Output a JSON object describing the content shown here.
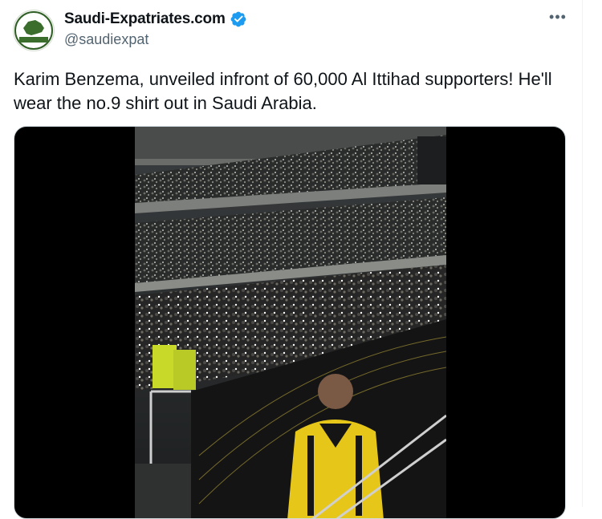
{
  "author": {
    "display_name": "Saudi-Expatriates.com",
    "handle": "@saudiexpat",
    "verified": true,
    "avatar_logo_text": "Saudi Expatriates.com",
    "avatar_icon": "saudi-map-logo"
  },
  "menu": {
    "more_label": "•••"
  },
  "tweet": {
    "text": "Karim Benzema, unveiled infront of 60,000 Al Ittihad supporters! He'll wear the no.9 shirt out in Saudi Arabia."
  },
  "media": {
    "type": "video",
    "frame_icon": "stadium-crowd-video"
  },
  "colors": {
    "verified_badge": "#1d9bf0",
    "text_primary": "#0f1419",
    "text_secondary": "#536471",
    "logo_green": "#3b6d2d",
    "jersey_yellow": "#e6c619"
  }
}
